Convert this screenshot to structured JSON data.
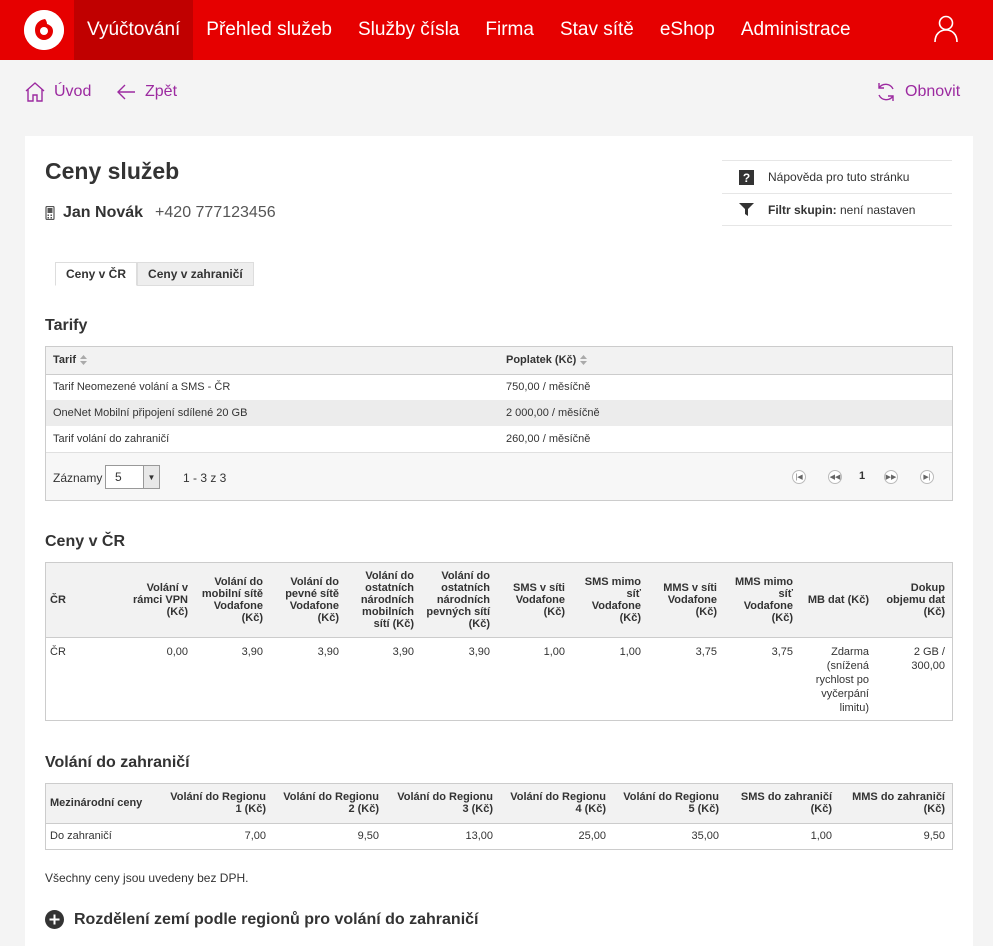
{
  "nav": {
    "items": [
      "Vyúčtování",
      "Přehled služeb",
      "Služby čísla",
      "Firma",
      "Stav sítě",
      "eShop",
      "Administrace"
    ],
    "active_index": 0,
    "brand_color": "#e60000",
    "active_color": "#c00000"
  },
  "actions": {
    "home": "Úvod",
    "back": "Zpět",
    "refresh": "Obnovit",
    "color": "#9c2aa0"
  },
  "page": {
    "title": "Ceny služeb",
    "subscriber_name": "Jan Novák",
    "subscriber_number": "+420 777123456"
  },
  "help": {
    "help_label": "Nápověda pro tuto stránku",
    "filter_label": "Filtr skupin:",
    "filter_value": " není nastaven"
  },
  "tabs": [
    "Ceny v ČR",
    "Ceny v zahraničí"
  ],
  "tariffs": {
    "title": "Tarify",
    "columns": [
      "Tarif",
      "Poplatek (Kč)"
    ],
    "rows": [
      [
        "Tarif Neomezené volání a SMS - ČR",
        "750,00 / měsíčně"
      ],
      [
        "OneNet Mobilní připojení sdílené 20 GB",
        "2 000,00 / měsíčně"
      ],
      [
        "Tarif volání do zahraničí",
        "260,00 / měsíčně"
      ]
    ],
    "pager": {
      "records_label": "Záznamy",
      "page_size": "5",
      "range": "1 - 3 z 3",
      "current_page": "1"
    }
  },
  "domestic": {
    "title": "Ceny v ČR",
    "columns": [
      "ČR",
      "Volání v rámci VPN (Kč)",
      "Volání do mobilní sítě Vodafone (Kč)",
      "Volání do pevné sítě Vodafone (Kč)",
      "Volání do ostatních národních mobilních sítí (Kč)",
      "Volání do ostatních národních pevných sítí (Kč)",
      "SMS v síti Vodafone (Kč)",
      "SMS mimo síť Vodafone (Kč)",
      "MMS v síti Vodafone (Kč)",
      "MMS mimo síť Vodafone (Kč)",
      "MB dat (Kč)",
      "Dokup objemu dat (Kč)"
    ],
    "rows": [
      [
        "ČR",
        "0,00",
        "3,90",
        "3,90",
        "3,90",
        "3,90",
        "1,00",
        "1,00",
        "3,75",
        "3,75",
        "Zdarma (snížená rychlost po vyčerpání limitu)",
        "2 GB / 300,00"
      ]
    ]
  },
  "international": {
    "title": "Volání do zahraničí",
    "columns": [
      "Mezinárodní ceny",
      "Volání do Regionu 1 (Kč)",
      "Volání do Regionu 2 (Kč)",
      "Volání do Regionu 3 (Kč)",
      "Volání do Regionu 4 (Kč)",
      "Volání do Regionu 5 (Kč)",
      "SMS do zahraničí (Kč)",
      "MMS do zahraničí (Kč)"
    ],
    "rows": [
      [
        "Do zahraničí",
        "7,00",
        "9,50",
        "13,00",
        "25,00",
        "35,00",
        "1,00",
        "9,50"
      ]
    ]
  },
  "footer": {
    "note": "Všechny ceny jsou uvedeny bez DPH.",
    "expander_label": "Rozdělení zemí podle regionů pro volání do zahraničí"
  }
}
